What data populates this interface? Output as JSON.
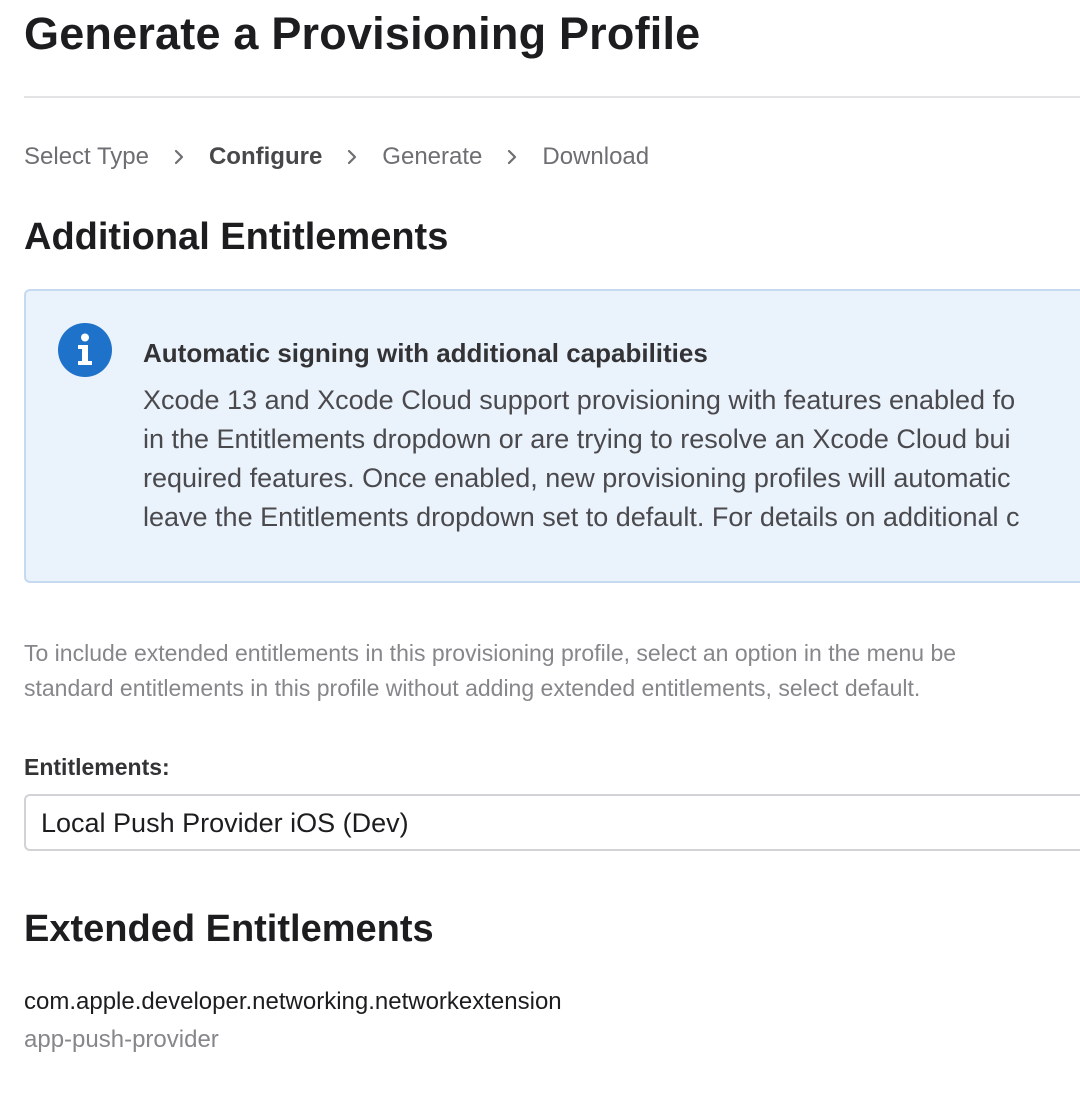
{
  "page": {
    "title": "Generate a Provisioning Profile"
  },
  "steps": [
    {
      "label": "Select Type",
      "current": false
    },
    {
      "label": "Configure",
      "current": true
    },
    {
      "label": "Generate",
      "current": false
    },
    {
      "label": "Download",
      "current": false
    }
  ],
  "additional_entitlements": {
    "heading": "Additional Entitlements",
    "notice": {
      "icon": "info-icon",
      "title": "Automatic signing with additional capabilities",
      "lines": [
        "Xcode 13 and Xcode Cloud support provisioning with features enabled fo",
        "in the Entitlements dropdown or are trying to resolve an Xcode Cloud bui",
        "required features. Once enabled, new provisioning profiles will automatic",
        "leave the Entitlements dropdown set to default. For details on additional c"
      ]
    },
    "helper_lines": [
      "To include extended entitlements in this provisioning profile, select an option in the menu be",
      "standard entitlements in this profile without adding extended entitlements, select default."
    ],
    "entitlements_label": "Entitlements:",
    "entitlements_selected": "Local Push Provider iOS (Dev)"
  },
  "extended_entitlements": {
    "heading": "Extended Entitlements",
    "items": [
      {
        "key": "com.apple.developer.networking.networkextension",
        "value": "app-push-provider"
      }
    ]
  },
  "colors": {
    "notice_background": "#eaf2fb",
    "notice_border": "#c5daf0",
    "info_icon": "#1f72c9",
    "muted_text": "#86868b"
  }
}
